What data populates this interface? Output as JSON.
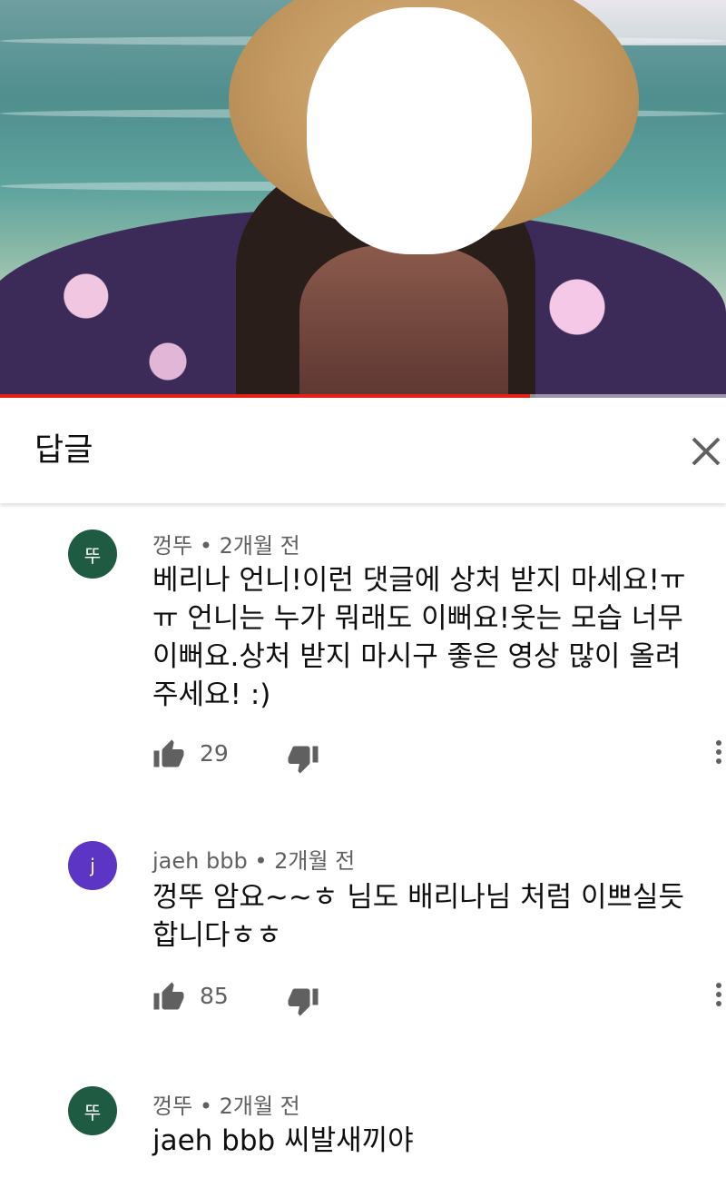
{
  "video": {
    "progress_fraction": 0.73,
    "progress_color": "#e62117"
  },
  "header": {
    "title": "답글",
    "close_icon": "close-icon"
  },
  "comments": [
    {
      "avatar_letter": "뚜",
      "avatar_color": "#1f5a43",
      "author": "껑뚜",
      "time": "2개월 전",
      "text": "베리나 언니!이런 댓글에 상처 받지 마세요!ㅠㅠ 언니는 누가 뭐래도 이뻐요!웃는 모습 너무 이뻐요.상처 받지 마시구 좋은 영상 많이 올려주세요! :)",
      "likes": "29"
    },
    {
      "avatar_letter": "j",
      "avatar_color": "#5c35c4",
      "author": "jaeh bbb",
      "time": "2개월 전",
      "text": "껑뚜 암요~~ㅎ 님도 배리나님 처럼 이쁘실듯 합니다ㅎㅎ",
      "likes": "85"
    },
    {
      "avatar_letter": "뚜",
      "avatar_color": "#1f5a43",
      "author": "껑뚜",
      "time": "2개월 전",
      "text": "jaeh bbb 씨발새끼야"
    }
  ]
}
